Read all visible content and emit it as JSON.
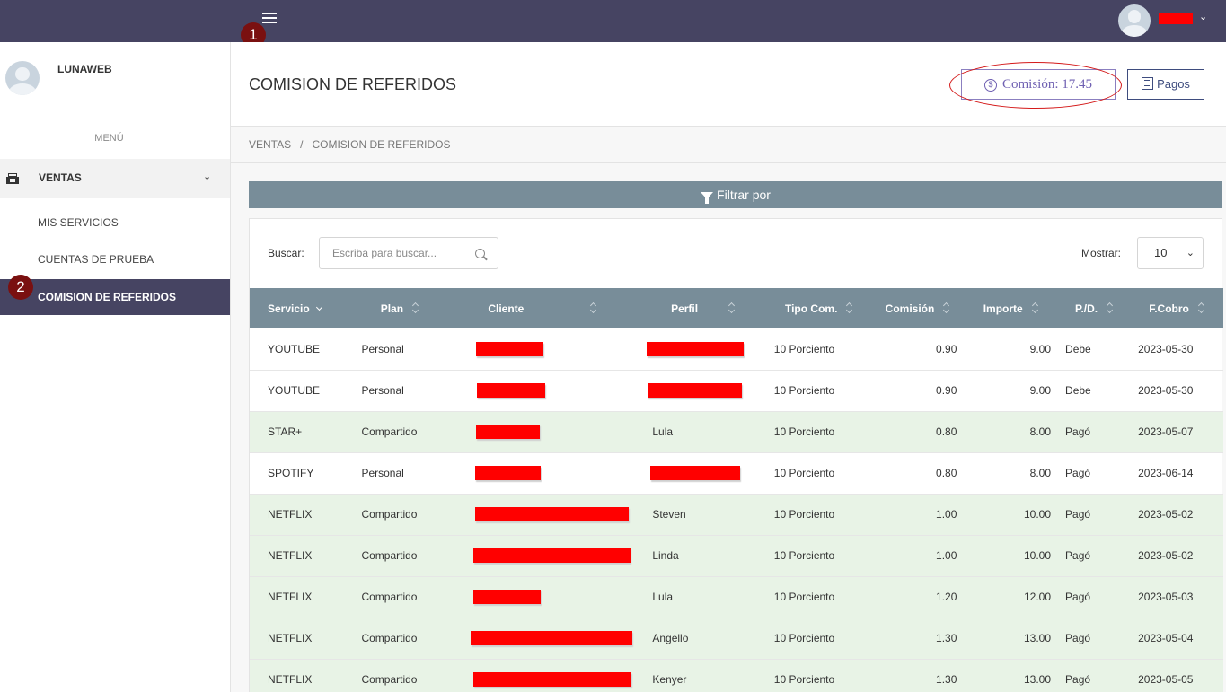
{
  "topbar": {
    "menu_marker": "1",
    "sidebar_marker": "2"
  },
  "sidebar": {
    "username": "LUNAWEB",
    "menu_label": "MENÚ",
    "section": "VENTAS",
    "items": [
      {
        "label": "MIS SERVICIOS",
        "active": false
      },
      {
        "label": "CUENTAS DE PRUEBA",
        "active": false
      },
      {
        "label": "COMISION DE REFERIDOS",
        "active": true
      }
    ]
  },
  "header": {
    "title": "COMISION DE REFERIDOS",
    "comision_label": "Comisión:",
    "comision_value": "17.45",
    "pagos_label": "Pagos"
  },
  "breadcrumb": {
    "root": "VENTAS",
    "separator": "/",
    "current": "COMISION DE REFERIDOS"
  },
  "filter": {
    "label": "Filtrar por"
  },
  "search": {
    "label": "Buscar:",
    "placeholder": "Escriba para buscar..."
  },
  "show": {
    "label": "Mostrar:",
    "value": "10"
  },
  "table": {
    "columns": [
      "Servicio",
      "Plan",
      "Cliente",
      "Perfil",
      "Tipo Com.",
      "Comisión",
      "Importe",
      "P./D.",
      "F.Cobro"
    ],
    "rows": [
      {
        "servicio": "YOUTUBE",
        "plan": "Personal",
        "perfil": "",
        "tipo": "10 Porciento",
        "comision": "0.90",
        "importe": "9.00",
        "pd": "Debe",
        "fcobro": "2023-05-30",
        "paid": false
      },
      {
        "servicio": "YOUTUBE",
        "plan": "Personal",
        "perfil": "",
        "tipo": "10 Porciento",
        "comision": "0.90",
        "importe": "9.00",
        "pd": "Debe",
        "fcobro": "2023-05-30",
        "paid": false
      },
      {
        "servicio": "STAR+",
        "plan": "Compartido",
        "perfil": "Lula",
        "tipo": "10 Porciento",
        "comision": "0.80",
        "importe": "8.00",
        "pd": "Pagó",
        "fcobro": "2023-05-07",
        "paid": true
      },
      {
        "servicio": "SPOTIFY",
        "plan": "Personal",
        "perfil": "",
        "tipo": "10 Porciento",
        "comision": "0.80",
        "importe": "8.00",
        "pd": "Pagó",
        "fcobro": "2023-06-14",
        "paid": false
      },
      {
        "servicio": "NETFLIX",
        "plan": "Compartido",
        "perfil": "Steven",
        "tipo": "10 Porciento",
        "comision": "1.00",
        "importe": "10.00",
        "pd": "Pagó",
        "fcobro": "2023-05-02",
        "paid": true
      },
      {
        "servicio": "NETFLIX",
        "plan": "Compartido",
        "perfil": "Linda",
        "tipo": "10 Porciento",
        "comision": "1.00",
        "importe": "10.00",
        "pd": "Pagó",
        "fcobro": "2023-05-02",
        "paid": true
      },
      {
        "servicio": "NETFLIX",
        "plan": "Compartido",
        "perfil": "Lula",
        "tipo": "10 Porciento",
        "comision": "1.20",
        "importe": "12.00",
        "pd": "Pagó",
        "fcobro": "2023-05-03",
        "paid": true
      },
      {
        "servicio": "NETFLIX",
        "plan": "Compartido",
        "perfil": "Angello",
        "tipo": "10 Porciento",
        "comision": "1.30",
        "importe": "13.00",
        "pd": "Pagó",
        "fcobro": "2023-05-04",
        "paid": true
      },
      {
        "servicio": "NETFLIX",
        "plan": "Compartido",
        "perfil": "Kenyer",
        "tipo": "10 Porciento",
        "comision": "1.30",
        "importe": "13.00",
        "pd": "Pagó",
        "fcobro": "2023-05-05",
        "paid": true
      }
    ]
  },
  "colors": {
    "topbar": "#464462",
    "table_header": "#788d99",
    "paid_row": "#e8f3e6",
    "redaction": "#ff0000",
    "accent": "#6f60b2"
  }
}
